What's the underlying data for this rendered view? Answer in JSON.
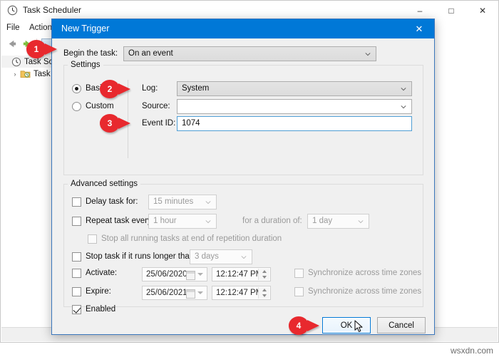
{
  "background_window": {
    "title": "Task Scheduler",
    "title_icon": "clock-icon",
    "caption_buttons": [
      {
        "name": "minimize",
        "glyph": "–"
      },
      {
        "name": "maximize",
        "glyph": "□"
      },
      {
        "name": "close",
        "glyph": "✕"
      }
    ],
    "menu": [
      {
        "label": "File"
      },
      {
        "label": "Action"
      }
    ],
    "toolbar": {
      "back_icon": "back-arrow-icon",
      "forward_icon": "forward-arrow-icon"
    },
    "tree": [
      {
        "label": "Task Sche",
        "icon": "clock-icon",
        "expander": "",
        "selected": true
      },
      {
        "label": "Task S",
        "icon": "folder-clock-icon",
        "expander": "›",
        "selected": false
      }
    ]
  },
  "dialog": {
    "title": "New Trigger",
    "close_glyph": "✕",
    "begin_task": {
      "label": "Begin the task:",
      "value": "On an event",
      "chevron": "chevron-down-icon"
    },
    "settings": {
      "group_title": "Settings",
      "mode_basic": "Basic",
      "mode_custom": "Custom",
      "mode_selected": "Basic",
      "log_label": "Log:",
      "log_value": "System",
      "source_label": "Source:",
      "source_value": "",
      "event_id_label": "Event ID:",
      "event_id_value": "1074"
    },
    "advanced": {
      "group_title": "Advanced settings",
      "delay_label": "Delay task for:",
      "delay_value": "15 minutes",
      "delay_checked": false,
      "repeat_label": "Repeat task every:",
      "repeat_value": "1 hour",
      "repeat_checked": false,
      "duration_label": "for a duration of:",
      "duration_value": "1 day",
      "stop_all_label": "Stop all running tasks at end of repetition duration",
      "stop_all_checked": false,
      "stop_if_label": "Stop task if it runs longer than:",
      "stop_if_value": "3 days",
      "stop_if_checked": false,
      "activate_label": "Activate:",
      "activate_date": "25/06/2020",
      "activate_time": "12:12:47 PM",
      "activate_checked": false,
      "activate_sync_label": "Synchronize across time zones",
      "activate_sync_checked": false,
      "expire_label": "Expire:",
      "expire_date": "25/06/2021",
      "expire_time": "12:12:47 PM",
      "expire_checked": false,
      "expire_sync_label": "Synchronize across time zones",
      "expire_sync_checked": false,
      "enabled_label": "Enabled",
      "enabled_checked": true
    },
    "buttons": {
      "ok": "OK",
      "cancel": "Cancel"
    }
  },
  "callouts": [
    {
      "number": "1"
    },
    {
      "number": "2"
    },
    {
      "number": "3"
    },
    {
      "number": "4"
    }
  ],
  "watermark": "wsxdn.com",
  "colors": {
    "accent_blue": "#0078d7",
    "callout_red": "#e8292e",
    "dialog_bg": "#f0f0f0",
    "focus_border": "#4f9ed4",
    "selection_blue": "#bdd6ee"
  }
}
